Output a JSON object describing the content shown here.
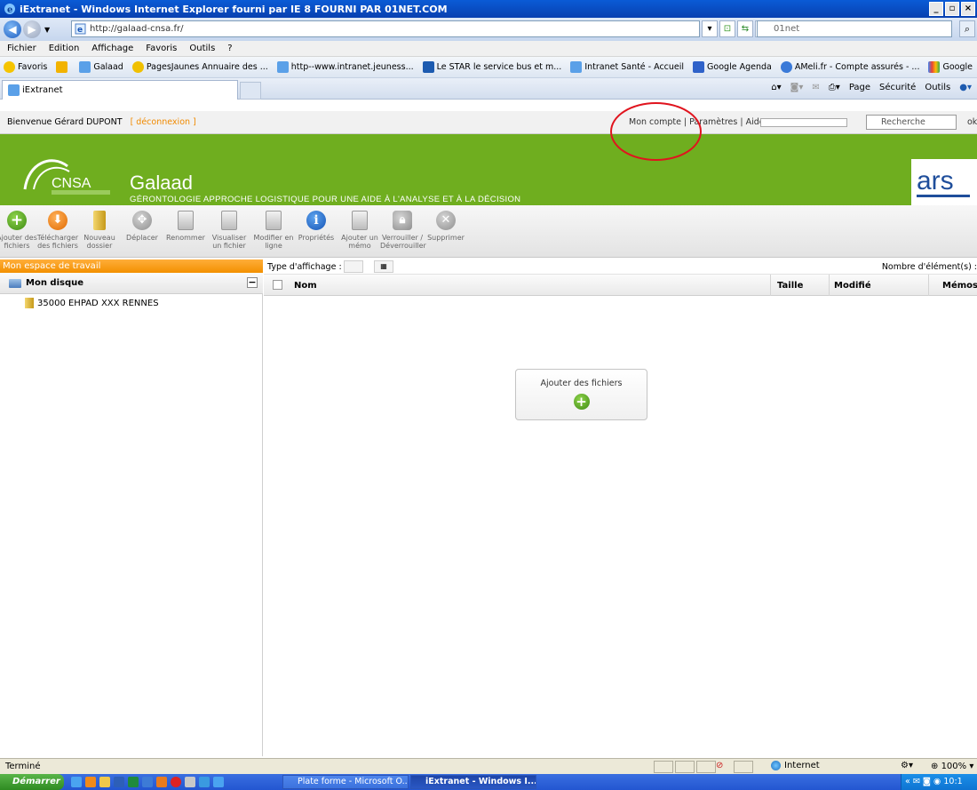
{
  "window": {
    "title": "iExtranet - Windows Internet Explorer fourni par IE 8 FOURNI PAR 01NET.COM"
  },
  "browser": {
    "url": "http://galaad-cnsa.fr/",
    "search_placeholder": "01net",
    "menu": [
      "Fichier",
      "Edition",
      "Affichage",
      "Favoris",
      "Outils",
      "?"
    ],
    "favorites": [
      "Favoris",
      "Galaad",
      "PagesJaunes Annuaire des ...",
      "http--www.intranet.jeuness...",
      "Le STAR le service bus et m...",
      "Intranet Santé - Accueil",
      "Google Agenda",
      "AMeli.fr - Compte assurés - ...",
      "Google"
    ],
    "tab_title": "iExtranet",
    "commands": [
      "Page",
      "Sécurité",
      "Outils"
    ]
  },
  "site": {
    "welcome": "Bienvenue Gérard DUPONT",
    "logout": "[ déconnexion ]",
    "links": "Mon compte | Paramètres | Aide",
    "search_placeholder": "Recherche",
    "ok": "ok",
    "logo_text": "CNSA",
    "app_title": "Galaad",
    "app_subtitle": "GÉRONTOLOGIE APPROCHE LOGISTIQUE POUR UNE AIDE À L'ANALYSE ET À LA DÉCISION",
    "ars_logo": "ars"
  },
  "toolbar": {
    "buttons": [
      {
        "label": "Ajouter des fichiers",
        "icon": "add-icon"
      },
      {
        "label": "Télécharger des fichiers",
        "icon": "download-icon"
      },
      {
        "label": "Nouveau dossier",
        "icon": "new-folder-icon"
      },
      {
        "label": "Déplacer",
        "icon": "move-icon"
      },
      {
        "label": "Renommer",
        "icon": "rename-icon"
      },
      {
        "label": "Visualiser un fichier",
        "icon": "view-file-icon"
      },
      {
        "label": "Modifier en ligne",
        "icon": "edit-online-icon"
      },
      {
        "label": "Propriétés",
        "icon": "info-icon"
      },
      {
        "label": "Ajouter un mémo",
        "icon": "memo-icon"
      },
      {
        "label": "Verrouiller / Déverrouiller",
        "icon": "lock-icon"
      },
      {
        "label": "Supprimer",
        "icon": "delete-icon"
      }
    ]
  },
  "left_panel": {
    "header": "Mon espace de travail",
    "disk": "Mon disque",
    "tree": [
      "35000 EHPAD XXX RENNES"
    ]
  },
  "main": {
    "view_label": "Type d'affichage :",
    "count_label": "Nombre d'élément(s) :",
    "columns": [
      "Nom",
      "Taille",
      "Modifié",
      "Mémos"
    ],
    "empty_action": "Ajouter des fichiers"
  },
  "status": {
    "text": "Terminé",
    "zone": "Internet",
    "zoom": "100%"
  },
  "taskbar": {
    "start": "Démarrer",
    "tasks": [
      "Plate forme - Microsoft O...",
      "iExtranet - Windows I..."
    ],
    "clock": "10:1"
  },
  "colors": {
    "green_header": "#6fae1f",
    "orange_panel": "#f39000",
    "annotation": "#e0141e"
  }
}
